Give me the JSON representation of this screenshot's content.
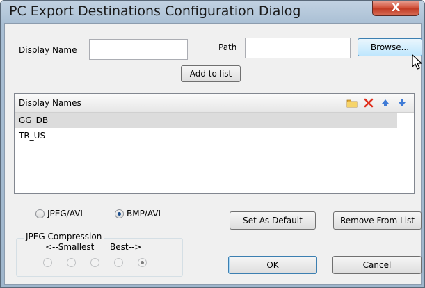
{
  "window": {
    "title": "PC Export Destinations Configuration Dialog",
    "close_glyph": "X"
  },
  "form": {
    "display_name_label": "Display Name",
    "display_name_value": "",
    "path_label": "Path",
    "path_value": "",
    "browse_button": "Browse...",
    "add_button": "Add to list"
  },
  "list": {
    "header": "Display Names",
    "items": [
      {
        "label": "GG_DB",
        "selected": true
      },
      {
        "label": "TR_US",
        "selected": false
      }
    ],
    "header_icons": [
      "folder-icon",
      "delete-icon",
      "move-up-icon",
      "move-down-icon"
    ]
  },
  "format": {
    "jpeg_label": "JPEG/AVI",
    "bmp_label": "BMP/AVI",
    "selected": "BMP/AVI"
  },
  "compression": {
    "title": "JPEG Compression",
    "smallest_label": "<--Smallest",
    "best_label": "Best-->",
    "levels": 5,
    "selected_level": 5
  },
  "buttons": {
    "set_default": "Set As Default",
    "remove": "Remove From List",
    "ok": "OK",
    "cancel": "Cancel"
  },
  "colors": {
    "delete_icon": "#e0301e",
    "arrow_icon": "#3f7bd6",
    "folder_icon": "#e8b33a"
  }
}
